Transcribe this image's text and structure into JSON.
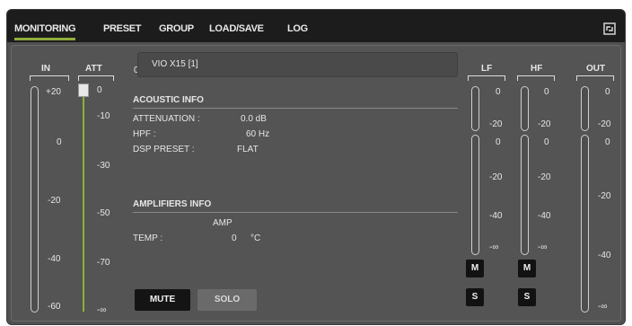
{
  "tabs": [
    {
      "label": "MONITORING",
      "active": true
    },
    {
      "label": "PRESET"
    },
    {
      "label": "GROUP"
    },
    {
      "label": "LOAD/SAVE"
    },
    {
      "label": "LOG"
    }
  ],
  "accent_color": "#8fae3a",
  "icons": {
    "refresh": "refresh-icon"
  },
  "in_meter": {
    "label": "IN",
    "scale": [
      "+20",
      "0",
      "-20",
      "-40",
      "-60"
    ]
  },
  "att_meter": {
    "label": "ATT",
    "scale": [
      "0",
      "-10",
      "-30",
      "-50",
      "-70",
      "-∞"
    ],
    "value": "0"
  },
  "device": {
    "id": "0.0.0",
    "name": "VIO X15 [1]"
  },
  "acoustic_info": {
    "title": "ACOUSTIC INFO",
    "attenuation_label": "ATTENUATION :",
    "attenuation_value": "0.0 dB",
    "hpf_label": "HPF :",
    "hpf_value": "60 Hz",
    "dsp_label": "DSP PRESET :",
    "dsp_value": "FLAT"
  },
  "amplifiers_info": {
    "title": "AMPLIFIERS INFO",
    "amp_label": "AMP",
    "temp_label": "TEMP :",
    "temp_value": "0",
    "temp_unit": "°C"
  },
  "buttons": {
    "mute": "MUTE",
    "solo": "SOLO",
    "m": "M",
    "s": "S"
  },
  "lf_meter": {
    "label": "LF",
    "upper_scale": [
      "0",
      "-20"
    ],
    "lower_scale": [
      "0",
      "-20",
      "-40",
      "-∞"
    ]
  },
  "hf_meter": {
    "label": "HF",
    "upper_scale": [
      "0",
      "-20"
    ],
    "lower_scale": [
      "0",
      "-20",
      "-40",
      "-∞"
    ]
  },
  "out_meter": {
    "label": "OUT",
    "upper_scale": [
      "0",
      "-20"
    ],
    "lower_scale": [
      "0",
      "-20",
      "-40",
      "-∞"
    ]
  }
}
